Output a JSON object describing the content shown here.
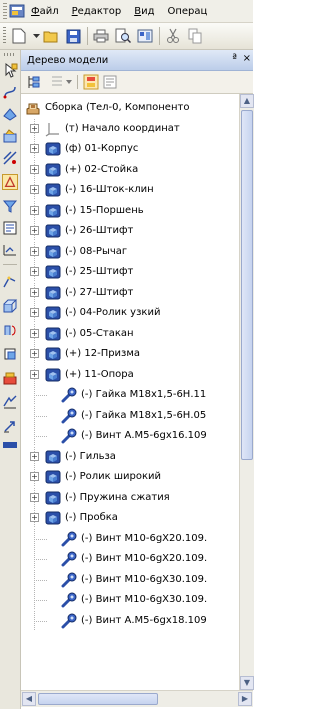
{
  "menubar": {
    "items": [
      {
        "label": "Файл",
        "mnemonic": "Ф"
      },
      {
        "label": "Редактор",
        "mnemonic": "Р"
      },
      {
        "label": "Вид",
        "mnemonic": "В"
      },
      {
        "label": "Операц",
        "mnemonic": ""
      }
    ]
  },
  "panel": {
    "title": "Дерево модели",
    "pin": "ª",
    "close": "×"
  },
  "tree": {
    "items": [
      {
        "label": "Сборка (Тел-0, Компоненто",
        "icon": "assembly-icon",
        "expander": "",
        "level": 0
      },
      {
        "label": "(т) Начало координат",
        "icon": "origin-icon",
        "expander": "+",
        "level": 1
      },
      {
        "label": "(ф) 01-Корпус",
        "icon": "part-icon",
        "expander": "+",
        "level": 1
      },
      {
        "label": "(+) 02-Стойка",
        "icon": "part-icon",
        "expander": "+",
        "level": 1
      },
      {
        "label": "(-) 16-Шток-клин",
        "icon": "part-icon",
        "expander": "+",
        "level": 1
      },
      {
        "label": "(-) 15-Поршень",
        "icon": "part-icon",
        "expander": "+",
        "level": 1
      },
      {
        "label": "(-) 26-Штифт",
        "icon": "part-icon",
        "expander": "+",
        "level": 1
      },
      {
        "label": "(-) 08-Рычаг",
        "icon": "part-icon",
        "expander": "+",
        "level": 1
      },
      {
        "label": "(-) 25-Штифт",
        "icon": "part-icon",
        "expander": "+",
        "level": 1
      },
      {
        "label": "(-) 27-Штифт",
        "icon": "part-icon",
        "expander": "+",
        "level": 1
      },
      {
        "label": "(-) 04-Ролик узкий",
        "icon": "part-icon",
        "expander": "+",
        "level": 1
      },
      {
        "label": "(-) 05-Стакан",
        "icon": "part-icon",
        "expander": "+",
        "level": 1
      },
      {
        "label": "(+) 12-Призма",
        "icon": "part-icon",
        "expander": "+",
        "level": 1
      },
      {
        "label": "(+) 11-Опора",
        "icon": "part-icon",
        "expander": "+",
        "level": 1
      },
      {
        "label": "(-) Гайка М18х1,5-6Н.11",
        "icon": "fastener-icon",
        "expander": "",
        "level": 1
      },
      {
        "label": "(-) Гайка М18х1,5-6Н.05",
        "icon": "fastener-icon",
        "expander": "",
        "level": 1
      },
      {
        "label": "(-) Винт А.М5-6gx16.109",
        "icon": "fastener-icon",
        "expander": "",
        "level": 1
      },
      {
        "label": "(-) Гильза",
        "icon": "part-icon",
        "expander": "+",
        "level": 1
      },
      {
        "label": "(-) Ролик широкий",
        "icon": "part-icon",
        "expander": "+",
        "level": 1
      },
      {
        "label": "(-) Пружина сжатия",
        "icon": "part-icon",
        "expander": "+",
        "level": 1
      },
      {
        "label": "(-) Пробка",
        "icon": "part-icon",
        "expander": "+",
        "level": 1
      },
      {
        "label": "(-) Винт М10-6gX20.109.",
        "icon": "fastener-icon",
        "expander": "",
        "level": 1
      },
      {
        "label": "(-) Винт М10-6gX20.109.",
        "icon": "fastener-icon",
        "expander": "",
        "level": 1
      },
      {
        "label": "(-) Винт М10-6gX30.109.",
        "icon": "fastener-icon",
        "expander": "",
        "level": 1
      },
      {
        "label": "(-) Винт М10-6gX30.109.",
        "icon": "fastener-icon",
        "expander": "",
        "level": 1
      },
      {
        "label": "(-) Винт А.М5-6gx18.109",
        "icon": "fastener-icon",
        "expander": "",
        "level": 1
      }
    ]
  },
  "colors": {
    "accent": "#c79a2d",
    "part_blue": "#2b4fa8",
    "header_blue": "#bccde9"
  }
}
